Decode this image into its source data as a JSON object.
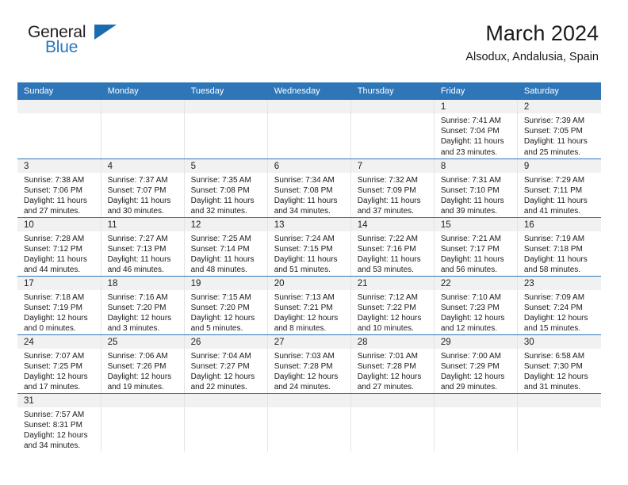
{
  "logo": {
    "word1": "General",
    "word2": "Blue"
  },
  "header": {
    "title": "March 2024",
    "subtitle": "Alsodux, Andalusia, Spain"
  },
  "weekdays": [
    "Sunday",
    "Monday",
    "Tuesday",
    "Wednesday",
    "Thursday",
    "Friday",
    "Saturday"
  ],
  "colors": {
    "header_blue": "#2e76b8",
    "logo_blue": "#2878bd",
    "daynum_band": "#f1f1f1",
    "text": "#1a1a1a"
  },
  "labels": {
    "sunrise": "Sunrise:",
    "sunset": "Sunset:",
    "daylight": "Daylight:"
  },
  "weeks": [
    [
      {
        "day": "",
        "sunrise": "",
        "sunset": "",
        "daylight1": "",
        "daylight2": "",
        "empty": true
      },
      {
        "day": "",
        "sunrise": "",
        "sunset": "",
        "daylight1": "",
        "daylight2": "",
        "empty": true
      },
      {
        "day": "",
        "sunrise": "",
        "sunset": "",
        "daylight1": "",
        "daylight2": "",
        "empty": true
      },
      {
        "day": "",
        "sunrise": "",
        "sunset": "",
        "daylight1": "",
        "daylight2": "",
        "empty": true
      },
      {
        "day": "",
        "sunrise": "",
        "sunset": "",
        "daylight1": "",
        "daylight2": "",
        "empty": true
      },
      {
        "day": "1",
        "sunrise": "Sunrise: 7:41 AM",
        "sunset": "Sunset: 7:04 PM",
        "daylight1": "Daylight: 11 hours",
        "daylight2": "and 23 minutes.",
        "empty": false
      },
      {
        "day": "2",
        "sunrise": "Sunrise: 7:39 AM",
        "sunset": "Sunset: 7:05 PM",
        "daylight1": "Daylight: 11 hours",
        "daylight2": "and 25 minutes.",
        "empty": false
      }
    ],
    [
      {
        "day": "3",
        "sunrise": "Sunrise: 7:38 AM",
        "sunset": "Sunset: 7:06 PM",
        "daylight1": "Daylight: 11 hours",
        "daylight2": "and 27 minutes.",
        "empty": false
      },
      {
        "day": "4",
        "sunrise": "Sunrise: 7:37 AM",
        "sunset": "Sunset: 7:07 PM",
        "daylight1": "Daylight: 11 hours",
        "daylight2": "and 30 minutes.",
        "empty": false
      },
      {
        "day": "5",
        "sunrise": "Sunrise: 7:35 AM",
        "sunset": "Sunset: 7:08 PM",
        "daylight1": "Daylight: 11 hours",
        "daylight2": "and 32 minutes.",
        "empty": false
      },
      {
        "day": "6",
        "sunrise": "Sunrise: 7:34 AM",
        "sunset": "Sunset: 7:08 PM",
        "daylight1": "Daylight: 11 hours",
        "daylight2": "and 34 minutes.",
        "empty": false
      },
      {
        "day": "7",
        "sunrise": "Sunrise: 7:32 AM",
        "sunset": "Sunset: 7:09 PM",
        "daylight1": "Daylight: 11 hours",
        "daylight2": "and 37 minutes.",
        "empty": false
      },
      {
        "day": "8",
        "sunrise": "Sunrise: 7:31 AM",
        "sunset": "Sunset: 7:10 PM",
        "daylight1": "Daylight: 11 hours",
        "daylight2": "and 39 minutes.",
        "empty": false
      },
      {
        "day": "9",
        "sunrise": "Sunrise: 7:29 AM",
        "sunset": "Sunset: 7:11 PM",
        "daylight1": "Daylight: 11 hours",
        "daylight2": "and 41 minutes.",
        "empty": false
      }
    ],
    [
      {
        "day": "10",
        "sunrise": "Sunrise: 7:28 AM",
        "sunset": "Sunset: 7:12 PM",
        "daylight1": "Daylight: 11 hours",
        "daylight2": "and 44 minutes.",
        "empty": false
      },
      {
        "day": "11",
        "sunrise": "Sunrise: 7:27 AM",
        "sunset": "Sunset: 7:13 PM",
        "daylight1": "Daylight: 11 hours",
        "daylight2": "and 46 minutes.",
        "empty": false
      },
      {
        "day": "12",
        "sunrise": "Sunrise: 7:25 AM",
        "sunset": "Sunset: 7:14 PM",
        "daylight1": "Daylight: 11 hours",
        "daylight2": "and 48 minutes.",
        "empty": false
      },
      {
        "day": "13",
        "sunrise": "Sunrise: 7:24 AM",
        "sunset": "Sunset: 7:15 PM",
        "daylight1": "Daylight: 11 hours",
        "daylight2": "and 51 minutes.",
        "empty": false
      },
      {
        "day": "14",
        "sunrise": "Sunrise: 7:22 AM",
        "sunset": "Sunset: 7:16 PM",
        "daylight1": "Daylight: 11 hours",
        "daylight2": "and 53 minutes.",
        "empty": false
      },
      {
        "day": "15",
        "sunrise": "Sunrise: 7:21 AM",
        "sunset": "Sunset: 7:17 PM",
        "daylight1": "Daylight: 11 hours",
        "daylight2": "and 56 minutes.",
        "empty": false
      },
      {
        "day": "16",
        "sunrise": "Sunrise: 7:19 AM",
        "sunset": "Sunset: 7:18 PM",
        "daylight1": "Daylight: 11 hours",
        "daylight2": "and 58 minutes.",
        "empty": false
      }
    ],
    [
      {
        "day": "17",
        "sunrise": "Sunrise: 7:18 AM",
        "sunset": "Sunset: 7:19 PM",
        "daylight1": "Daylight: 12 hours",
        "daylight2": "and 0 minutes.",
        "empty": false
      },
      {
        "day": "18",
        "sunrise": "Sunrise: 7:16 AM",
        "sunset": "Sunset: 7:20 PM",
        "daylight1": "Daylight: 12 hours",
        "daylight2": "and 3 minutes.",
        "empty": false
      },
      {
        "day": "19",
        "sunrise": "Sunrise: 7:15 AM",
        "sunset": "Sunset: 7:20 PM",
        "daylight1": "Daylight: 12 hours",
        "daylight2": "and 5 minutes.",
        "empty": false
      },
      {
        "day": "20",
        "sunrise": "Sunrise: 7:13 AM",
        "sunset": "Sunset: 7:21 PM",
        "daylight1": "Daylight: 12 hours",
        "daylight2": "and 8 minutes.",
        "empty": false
      },
      {
        "day": "21",
        "sunrise": "Sunrise: 7:12 AM",
        "sunset": "Sunset: 7:22 PM",
        "daylight1": "Daylight: 12 hours",
        "daylight2": "and 10 minutes.",
        "empty": false
      },
      {
        "day": "22",
        "sunrise": "Sunrise: 7:10 AM",
        "sunset": "Sunset: 7:23 PM",
        "daylight1": "Daylight: 12 hours",
        "daylight2": "and 12 minutes.",
        "empty": false
      },
      {
        "day": "23",
        "sunrise": "Sunrise: 7:09 AM",
        "sunset": "Sunset: 7:24 PM",
        "daylight1": "Daylight: 12 hours",
        "daylight2": "and 15 minutes.",
        "empty": false
      }
    ],
    [
      {
        "day": "24",
        "sunrise": "Sunrise: 7:07 AM",
        "sunset": "Sunset: 7:25 PM",
        "daylight1": "Daylight: 12 hours",
        "daylight2": "and 17 minutes.",
        "empty": false
      },
      {
        "day": "25",
        "sunrise": "Sunrise: 7:06 AM",
        "sunset": "Sunset: 7:26 PM",
        "daylight1": "Daylight: 12 hours",
        "daylight2": "and 19 minutes.",
        "empty": false
      },
      {
        "day": "26",
        "sunrise": "Sunrise: 7:04 AM",
        "sunset": "Sunset: 7:27 PM",
        "daylight1": "Daylight: 12 hours",
        "daylight2": "and 22 minutes.",
        "empty": false
      },
      {
        "day": "27",
        "sunrise": "Sunrise: 7:03 AM",
        "sunset": "Sunset: 7:28 PM",
        "daylight1": "Daylight: 12 hours",
        "daylight2": "and 24 minutes.",
        "empty": false
      },
      {
        "day": "28",
        "sunrise": "Sunrise: 7:01 AM",
        "sunset": "Sunset: 7:28 PM",
        "daylight1": "Daylight: 12 hours",
        "daylight2": "and 27 minutes.",
        "empty": false
      },
      {
        "day": "29",
        "sunrise": "Sunrise: 7:00 AM",
        "sunset": "Sunset: 7:29 PM",
        "daylight1": "Daylight: 12 hours",
        "daylight2": "and 29 minutes.",
        "empty": false
      },
      {
        "day": "30",
        "sunrise": "Sunrise: 6:58 AM",
        "sunset": "Sunset: 7:30 PM",
        "daylight1": "Daylight: 12 hours",
        "daylight2": "and 31 minutes.",
        "empty": false
      }
    ],
    [
      {
        "day": "31",
        "sunrise": "Sunrise: 7:57 AM",
        "sunset": "Sunset: 8:31 PM",
        "daylight1": "Daylight: 12 hours",
        "daylight2": "and 34 minutes.",
        "empty": false
      },
      {
        "day": "",
        "sunrise": "",
        "sunset": "",
        "daylight1": "",
        "daylight2": "",
        "empty": true
      },
      {
        "day": "",
        "sunrise": "",
        "sunset": "",
        "daylight1": "",
        "daylight2": "",
        "empty": true
      },
      {
        "day": "",
        "sunrise": "",
        "sunset": "",
        "daylight1": "",
        "daylight2": "",
        "empty": true
      },
      {
        "day": "",
        "sunrise": "",
        "sunset": "",
        "daylight1": "",
        "daylight2": "",
        "empty": true
      },
      {
        "day": "",
        "sunrise": "",
        "sunset": "",
        "daylight1": "",
        "daylight2": "",
        "empty": true
      },
      {
        "day": "",
        "sunrise": "",
        "sunset": "",
        "daylight1": "",
        "daylight2": "",
        "empty": true
      }
    ]
  ]
}
